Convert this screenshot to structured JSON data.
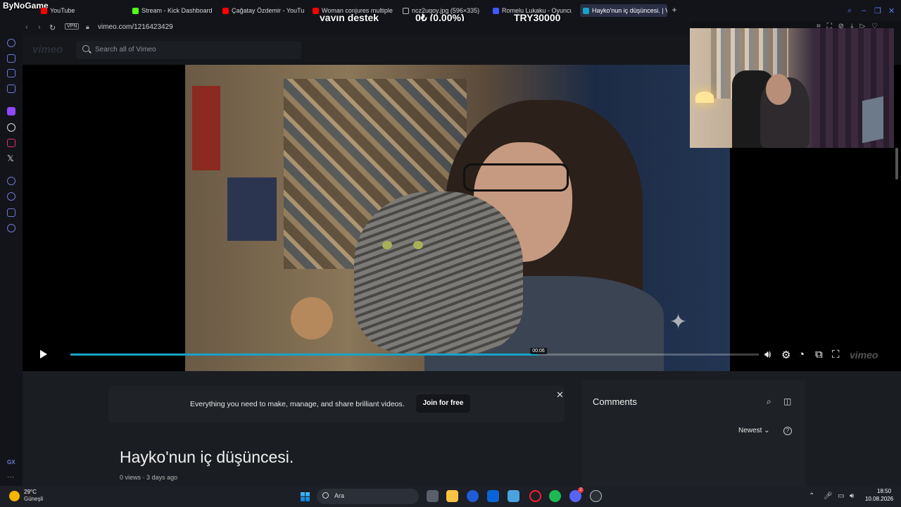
{
  "browser": {
    "brand": "ByNoGame",
    "tabs": [
      {
        "label": "YouTube",
        "color": "#ff0000"
      },
      {
        "label": "Stream - Kick Dashboard",
        "color": "#53fc18"
      },
      {
        "label": "Çağatay Özdemir - YouTube",
        "color": "#ff0000"
      },
      {
        "label": "Woman conjures multiple p",
        "color": "#ff0000"
      },
      {
        "label": "ncz2uqoy.jpg (596×335)",
        "color": "#bbbbbb"
      },
      {
        "label": "Romelu Lukaku - Oyuncu p",
        "color": "#3d5afe"
      },
      {
        "label": "Hayko'nun iç düşüncesi. | V",
        "color": "#17a3c7"
      }
    ],
    "url": "vimeo.com/1216423429",
    "vpn_label": "VPN"
  },
  "stream_overlay": {
    "goal_label": "yayın destek",
    "goal_progress": "0₺ (0.00%)",
    "goal_target": "TRY30000"
  },
  "vimeo": {
    "logo": "vimeo",
    "search_placeholder": "Search all of Vimeo",
    "player": {
      "time": "00:06",
      "progress": 0.68,
      "watermark": "vimeo"
    },
    "promo": {
      "text": "Everything you need to make, manage, and share brilliant videos.",
      "cta": "Join for free"
    },
    "video_title": "Hayko'nun iç düşüncesi.",
    "meta": {
      "views": "0 views",
      "separator": "·",
      "date": "3 days ago"
    },
    "comments": {
      "heading": "Comments",
      "sort": "Newest",
      "help": "?"
    }
  },
  "sidebar": {
    "gx_label": "GX",
    "more": "···"
  },
  "taskbar": {
    "weather_temp": "29°C",
    "weather_desc": "Güneşli",
    "search_label": "Ara",
    "time": "18:50",
    "date": "10.08.2026",
    "discord_badge": "2"
  },
  "colors": {
    "accent": "#17a3c7",
    "opera": "#6b7bd6"
  }
}
